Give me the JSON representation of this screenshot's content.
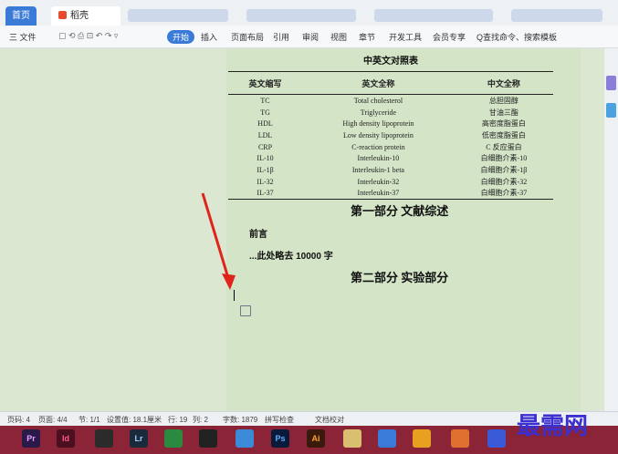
{
  "tabs": {
    "home": "首页",
    "doc": "稻壳"
  },
  "menu": {
    "file": "三 文件",
    "start": "开始",
    "insert": "插入",
    "layout": "页面布局",
    "reference": "引用",
    "review": "审阅",
    "view": "视图",
    "section": "章节",
    "dev": "开发工具",
    "member": "会员专享",
    "search": "Q查找命令、搜索模板"
  },
  "document": {
    "table_caption": "中英文对照表",
    "headers": [
      "英文缩写",
      "英文全称",
      "中文全称"
    ],
    "rows": [
      [
        "TC",
        "Total cholesterol",
        "总胆固醇"
      ],
      [
        "TG",
        "Triglyceride",
        "甘油三酯"
      ],
      [
        "HDL",
        "High density lipoprotein",
        "高密度脂蛋白"
      ],
      [
        "LDL",
        "Low density lipoprotein",
        "低密度脂蛋白"
      ],
      [
        "CRP",
        "C-reaction protein",
        "C 反应蛋白"
      ],
      [
        "IL-10",
        "Interleukin-10",
        "白细胞介素-10"
      ],
      [
        "IL-1β",
        "Interleukin-1 beta",
        "白细胞介素-1β"
      ],
      [
        "IL-32",
        "Interleukin-32",
        "白细胞介素-32"
      ],
      [
        "IL-37",
        "Interleukin-37",
        "白细胞介素-37"
      ]
    ],
    "part1": "第一部分 文献综述",
    "preface": "前言",
    "omitted": "...此处略去 10000 字",
    "part2": "第二部分 实验部分"
  },
  "status": {
    "page": "页码: 4",
    "pages": "页面: 4/4",
    "section": "节: 1/1",
    "position": "设置值: 18.1厘米",
    "row": "行: 19",
    "col": "列: 2",
    "words": "字数: 1879",
    "spell": "拼写检查",
    "proof": "文档校对"
  },
  "taskbar": [
    "Pr",
    "Id",
    "Lr",
    "Ps",
    "Ai"
  ],
  "watermark": "最需网"
}
